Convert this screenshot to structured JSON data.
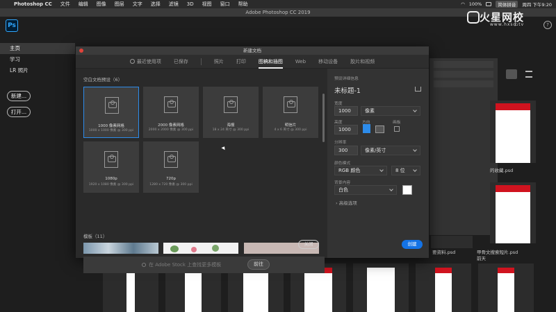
{
  "menubar": {
    "app_name": "Photoshop CC",
    "menus": [
      "文件",
      "编辑",
      "图像",
      "图层",
      "文字",
      "选择",
      "滤镜",
      "3D",
      "视图",
      "窗口",
      "帮助"
    ],
    "status": {
      "battery": "100%",
      "input_method": "简体拼音",
      "datetime": "周四 下午9:20"
    }
  },
  "window_title": "Adobe Photoshop CC 2019",
  "app_logo": "Ps",
  "left_nav": {
    "items": [
      "主页",
      "学习",
      "LR 照片"
    ],
    "new_button": "新建...",
    "open_button": "打开..."
  },
  "watermark": {
    "brand": "火星网校",
    "url": "www.hxsd.tv"
  },
  "background_files": [
    {
      "caption": "的收藏.psd"
    },
    {
      "caption": "要资料.psd"
    },
    {
      "caption": "甲骨文搜索短片.psd"
    },
    {
      "caption": "前天"
    },
    {
      "caption": "前天"
    }
  ],
  "modal": {
    "title": "新建文档",
    "tabs": [
      "最近使用项",
      "已保存",
      "照片",
      "打印",
      "图稿和插图",
      "Web",
      "移动设备",
      "胶片和视频"
    ],
    "active_tab": "图稿和插图",
    "blank_section_title": "空白文档预设（6）",
    "presets": [
      {
        "name": "1000 像素网格",
        "sub": "1000 x 1000 像素 @ 300 ppi"
      },
      {
        "name": "2000 像素网格",
        "sub": "2000 x 2000 像素 @ 300 ppi"
      },
      {
        "name": "海报",
        "sub": "18 x 24 英寸 @ 300 ppi"
      },
      {
        "name": "明信片",
        "sub": "4 x 6 英寸 @ 300 ppi"
      },
      {
        "name": "1080p",
        "sub": "1920 x 1080 像素 @ 300 ppi"
      },
      {
        "name": "720p",
        "sub": "1280 x 720 像素 @ 300 ppi"
      }
    ],
    "templates_title": "模板（11）",
    "stock_search_placeholder": "在 Adobe Stock 上查找更多模板",
    "go_button": "前往",
    "details": {
      "section_label": "预设详细信息",
      "doc_name": "未标题-1",
      "width_label": "宽度",
      "width_value": "1000",
      "width_unit": "像素",
      "height_label": "高度",
      "height_value": "1000",
      "orientation_label": "方向",
      "artboard_label": "画板",
      "resolution_label": "分辨率",
      "resolution_value": "300",
      "resolution_unit": "像素/英寸",
      "color_mode_label": "颜色模式",
      "color_mode_value": "RGB 颜色",
      "bit_depth_value": "8 位",
      "background_label": "背景内容",
      "background_value": "白色",
      "advanced_label": "高级选项"
    },
    "close_button": "关闭",
    "create_button": "创建"
  }
}
